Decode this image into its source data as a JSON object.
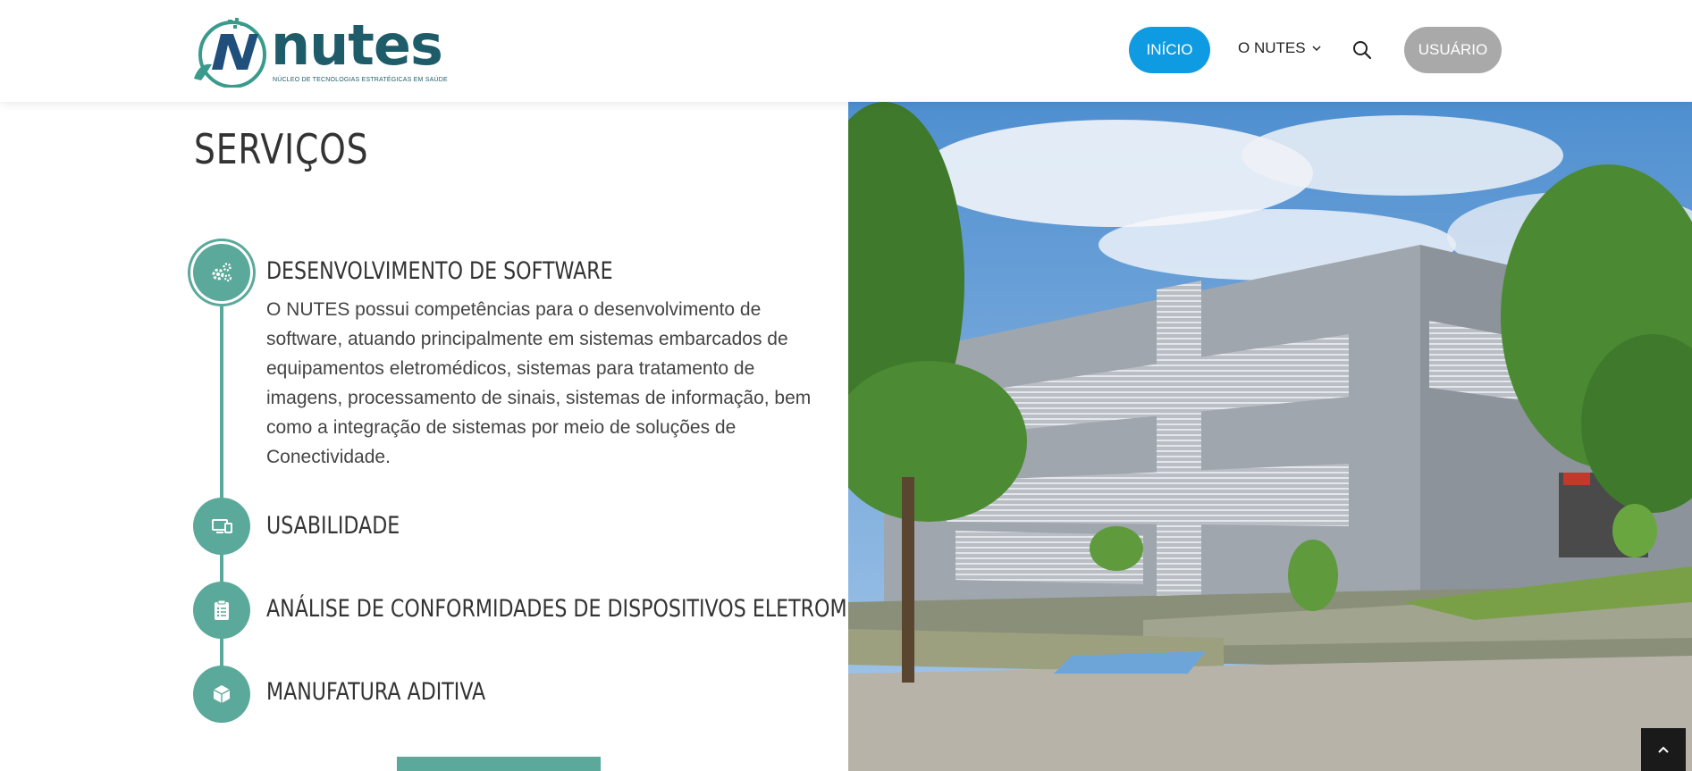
{
  "header": {
    "logo_text": "nutes",
    "logo_tagline": "NÚCLEO DE TECNOLOGIAS ESTRATÉGICAS EM SAÚDE",
    "nav": {
      "inicio": "INÍCIO",
      "o_nutes": "O NUTES",
      "usuario": "USUÁRIO"
    }
  },
  "main": {
    "title": "SERVIÇOS",
    "services": [
      {
        "title": "DESENVOLVIMENTO DE SOFTWARE",
        "icon": "gears-icon",
        "description": "O NUTES possui competências para o desenvolvimento de software, atuando principalmente em sistemas embarcados de equipamentos eletromédicos, sistemas para tratamento de imagens, processamento de sinais, sistemas de informação, bem como a integração de sistemas por meio de soluções de Conectividade."
      },
      {
        "title": "USABILIDADE",
        "icon": "devices-icon"
      },
      {
        "title": "ANÁLISE DE CONFORMIDADES DE DISPOSITIVOS ELETROMÉDICOS",
        "icon": "clipboard-list-icon"
      },
      {
        "title": "MANUFATURA ADITIVA",
        "icon": "cube-icon"
      }
    ]
  },
  "colors": {
    "accent": "#5ba99a",
    "primary_button": "#0e9be2",
    "user_button": "#a9a9a9"
  }
}
